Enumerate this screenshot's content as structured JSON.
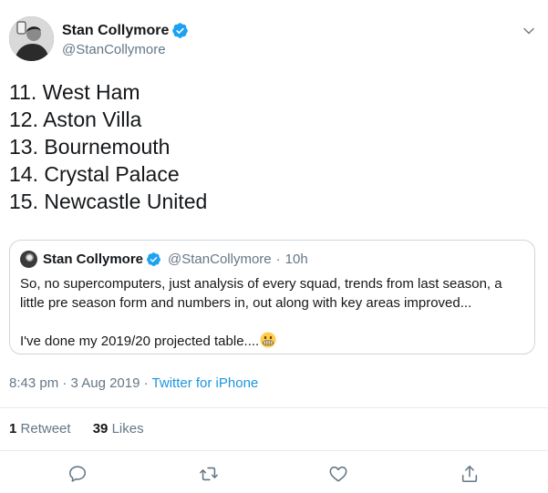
{
  "author": {
    "display_name": "Stan Collymore",
    "handle": "@StanCollymore",
    "avatar": "avatar-photo",
    "verified_icon": "verified-badge-icon"
  },
  "tweet": {
    "lines": [
      "11. West Ham",
      "12. Aston Villa",
      "13. Bournemouth",
      "14. Crystal Palace",
      "15. Newcastle United"
    ]
  },
  "quoted_tweet": {
    "display_name": "Stan Collymore",
    "handle": "@StanCollymore",
    "separator": "·",
    "age": "10h",
    "paragraph_1": "So, no supercomputers, just analysis of every squad, trends from last season, a little pre season form and numbers in, out along with key areas improved...",
    "paragraph_2": "I've done my 2019/20 projected table....",
    "emoji": "grimacing-face-icon"
  },
  "meta": {
    "time": "8:43 pm",
    "separator": "·",
    "date": "3 Aug 2019",
    "source": "Twitter for iPhone"
  },
  "stats": {
    "retweets_count": "1",
    "retweets_label": "Retweet",
    "likes_count": "39",
    "likes_label": "Likes"
  },
  "actions": [
    "reply-icon",
    "retweet-icon",
    "like-icon",
    "share-icon"
  ],
  "colors": {
    "text": "#14171a",
    "secondary": "#657786",
    "link": "#1b95e0",
    "border": "#ccd6dd",
    "divider": "#e6ecf0"
  }
}
